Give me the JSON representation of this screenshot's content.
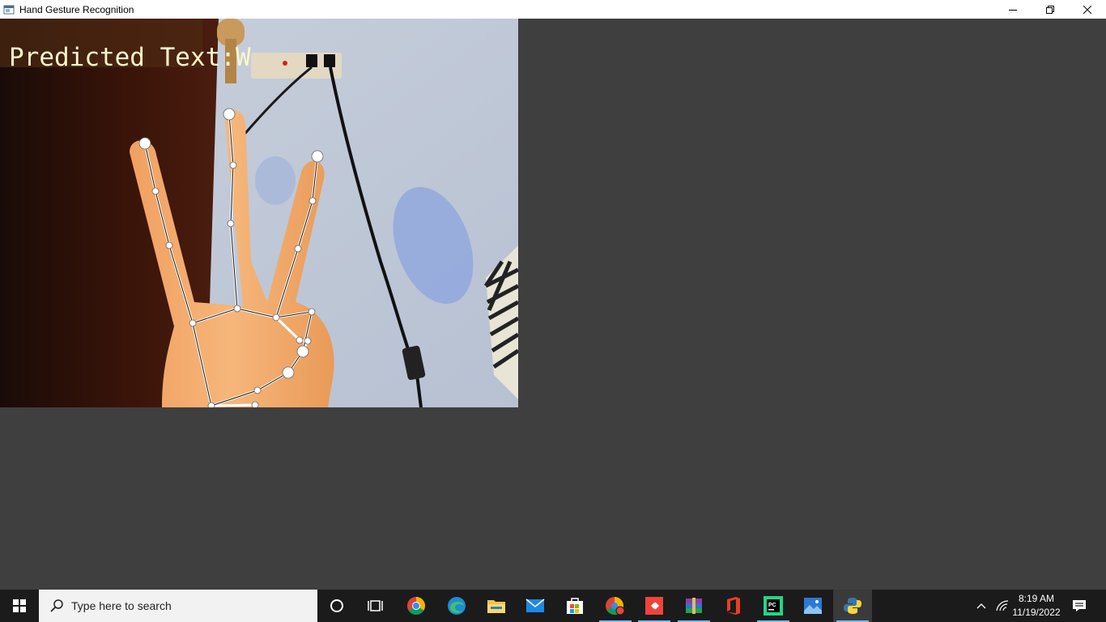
{
  "window": {
    "title": "Hand Gesture Recognition"
  },
  "overlay": {
    "predicted_text": "Predicted Text:W"
  },
  "taskbar": {
    "search_placeholder": "Type here to search",
    "time": "8:19 AM",
    "date": "11/19/2022",
    "pinned": [
      "cortana-icon",
      "task-view-icon",
      "chrome-icon",
      "edge-icon",
      "file-explorer-icon",
      "mail-icon",
      "store-icon",
      "chrome-profile-icon",
      "anydesk-icon",
      "winrar-icon",
      "office-icon",
      "pycharm-icon",
      "photos-icon",
      "python-icon"
    ]
  },
  "colors": {
    "taskbar": "#1b1b1b",
    "client_bg": "#3f3f3f",
    "overlay_text": "#fdf6cc"
  }
}
